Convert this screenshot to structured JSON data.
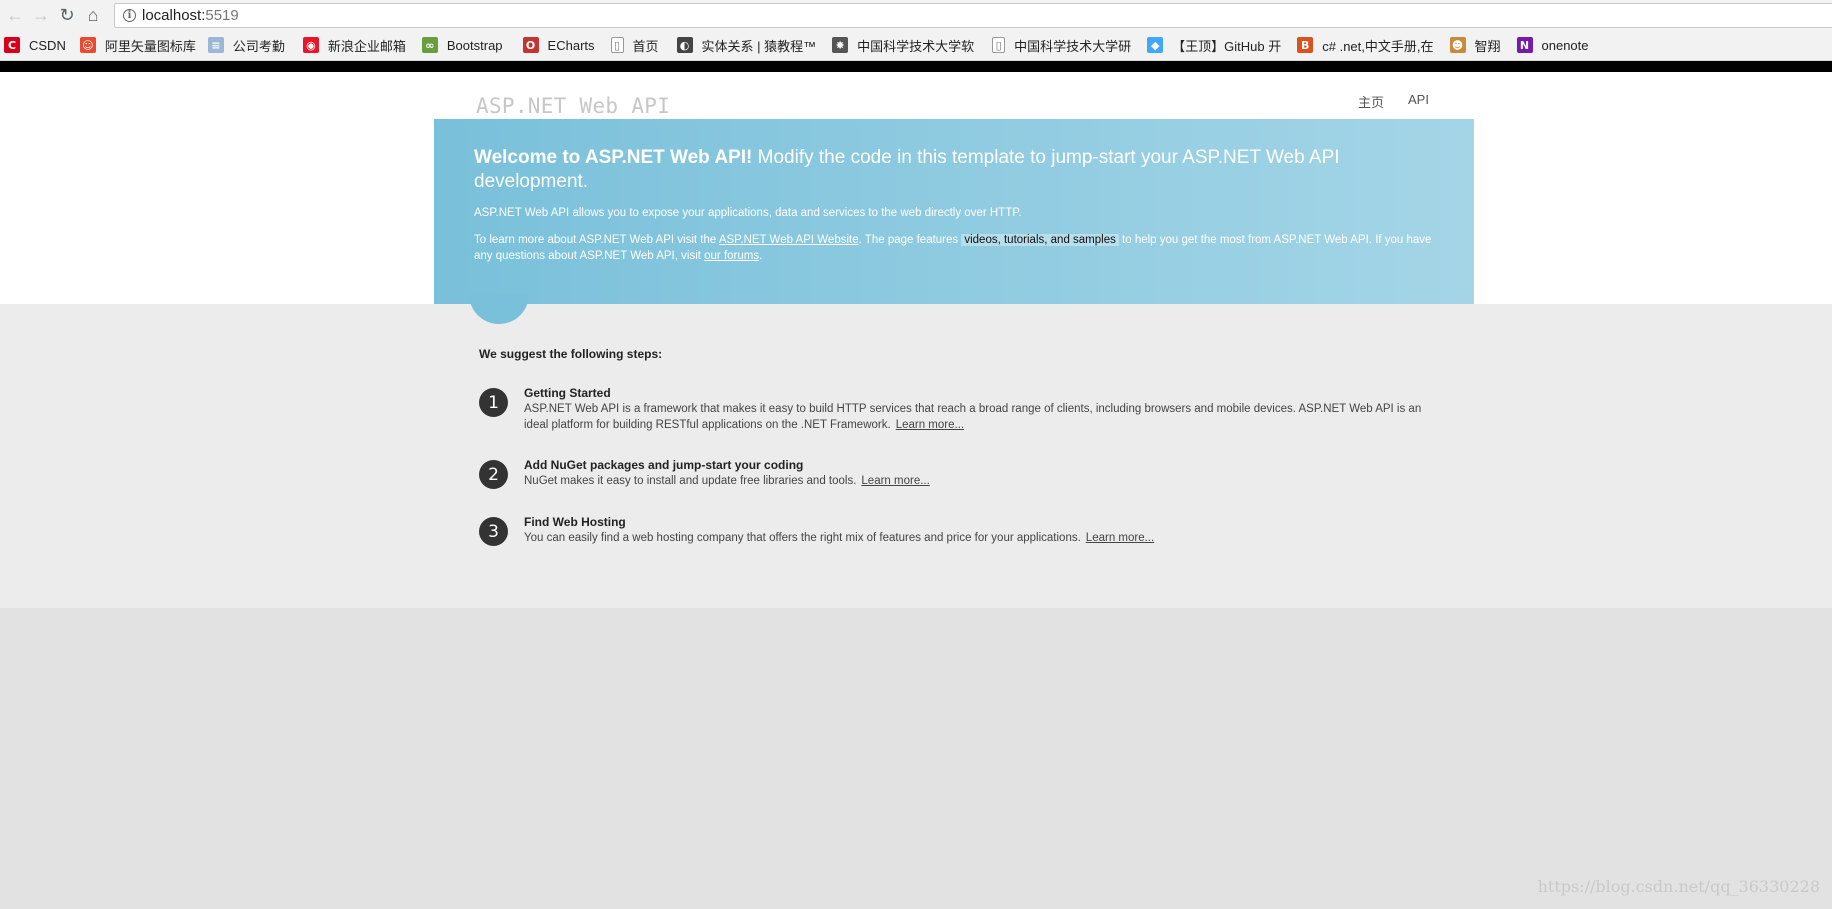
{
  "browser": {
    "url_host": "localhost:",
    "url_port": "5519",
    "bookmarks": [
      {
        "label": "CSDN",
        "icon": "csdn-icon",
        "color": "#d6001c",
        "glyph": "C"
      },
      {
        "label": "阿里矢量图标库",
        "icon": "iconfont-icon",
        "color": "#ea4a2f",
        "glyph": "☺"
      },
      {
        "label": "公司考勤",
        "icon": "document-icon",
        "color": "#9bb7d6",
        "glyph": "≡"
      },
      {
        "label": "新浪企业邮箱",
        "icon": "weibo-icon",
        "color": "#e6162d",
        "glyph": "◉"
      },
      {
        "label": "Bootstrap",
        "icon": "bootstrap-icon",
        "color": "#6a9e3d",
        "glyph": "∞"
      },
      {
        "label": "ECharts",
        "icon": "echarts-icon",
        "color": "#c23531",
        "glyph": "O"
      },
      {
        "label": "首页",
        "icon": "page-icon",
        "color": "#ffffff",
        "glyph": "▯"
      },
      {
        "label": "实体关系 | 猿教程™",
        "icon": "yuanjiaocheng-icon",
        "color": "#444444",
        "glyph": "◐"
      },
      {
        "label": "中国科学技术大学软",
        "icon": "ustc-icon",
        "color": "#555555",
        "glyph": "✸"
      },
      {
        "label": "中国科学技术大学研",
        "icon": "page-icon",
        "color": "#ffffff",
        "glyph": "▯"
      },
      {
        "label": "【王顶】GitHub 开",
        "icon": "diamond-icon",
        "color": "#3fa9f5",
        "glyph": "◆"
      },
      {
        "label": "c# .net,中文手册,在",
        "icon": "js-icon",
        "color": "#d9531e",
        "glyph": "B"
      },
      {
        "label": "智翔",
        "icon": "avatar-icon",
        "color": "#c98a3a",
        "glyph": "☻"
      },
      {
        "label": "onenote",
        "icon": "onenote-icon",
        "color": "#7719aa",
        "glyph": "N"
      }
    ]
  },
  "site": {
    "title": "ASP.NET Web API",
    "nav": [
      {
        "label": "主页"
      },
      {
        "label": "API"
      }
    ]
  },
  "hero": {
    "heading_bold": "Welcome to ASP.NET Web API!",
    "heading_rest": " Modify the code in this template to jump-start your ASP.NET Web API development.",
    "intro": "ASP.NET Web API allows you to expose your applications, data and services to the web directly over HTTP.",
    "learn_prefix": "To learn more about ASP.NET Web API visit the ",
    "learn_link": "ASP.NET Web API Website",
    "learn_middle": ". The page features ",
    "learn_pill": "videos, tutorials, and samples",
    "learn_suffix": " to help you get the most from ASP.NET Web API. If you have any questions about ASP.NET Web API, visit ",
    "forums_link": "our forums",
    "forums_suffix": "."
  },
  "steps": {
    "title": "We suggest the following steps:",
    "items": [
      {
        "number": "1",
        "title": "Getting Started",
        "text": "ASP.NET Web API is a framework that makes it easy to build HTTP services that reach a broad range of clients, including browsers and mobile devices. ASP.NET Web API is an ideal platform for building RESTful applications on the .NET Framework.",
        "link": "Learn more..."
      },
      {
        "number": "2",
        "title": "Add NuGet packages and jump-start your coding",
        "text": "NuGet makes it easy to install and update free libraries and tools.",
        "link": "Learn more..."
      },
      {
        "number": "3",
        "title": "Find Web Hosting",
        "text": "You can easily find a web hosting company that offers the right mix of features and price for your applications.",
        "link": "Learn more..."
      }
    ]
  },
  "watermark": "https://blog.csdn.net/qq_36330228"
}
